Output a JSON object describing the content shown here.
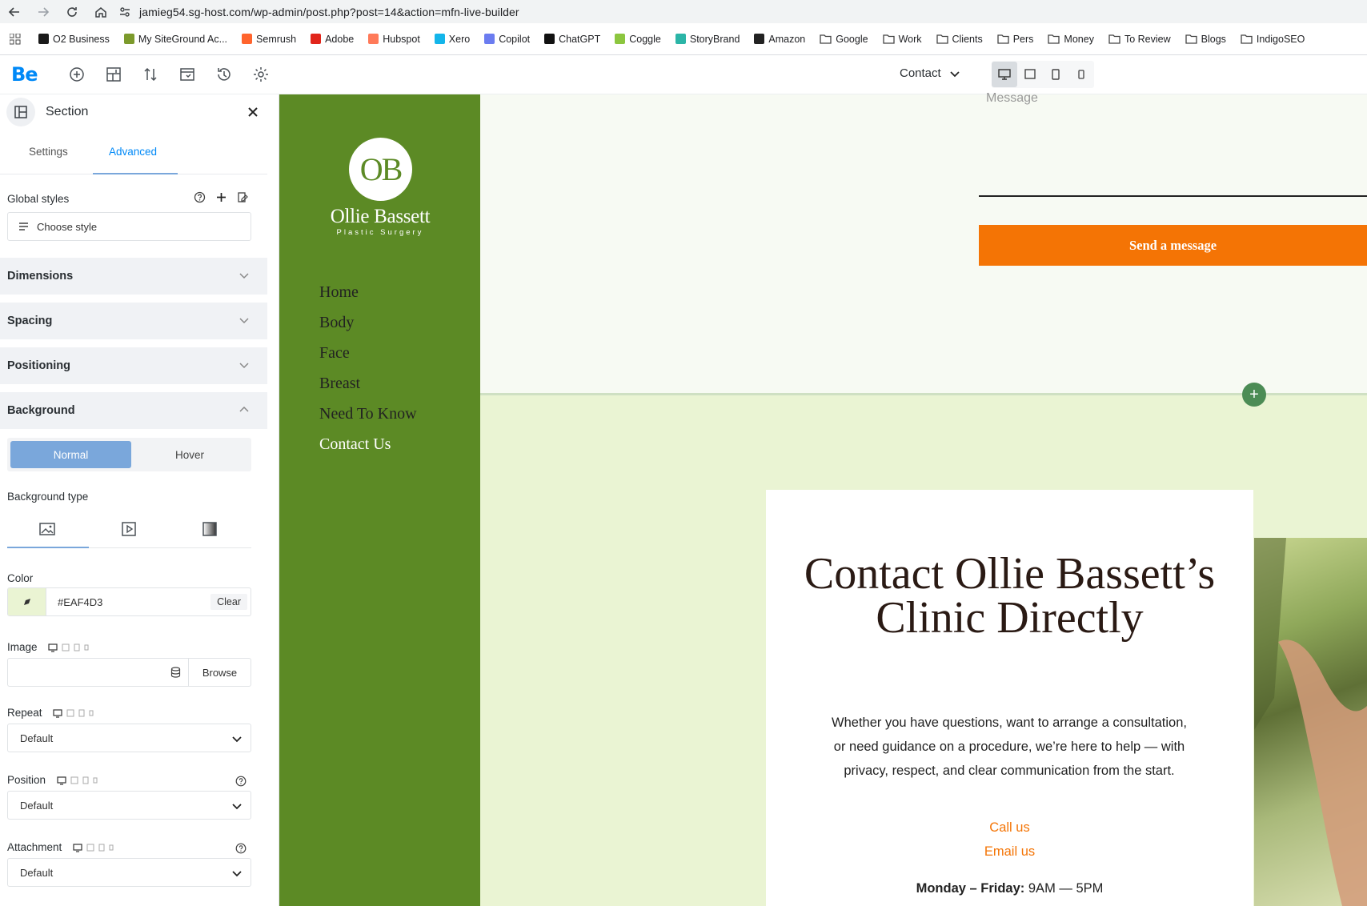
{
  "browser": {
    "url": "jamieg54.sg-host.com/wp-admin/post.php?post=14&action=mfn-live-builder",
    "bookmarks": [
      {
        "label": "O2 Business",
        "color": "#1a1a1a"
      },
      {
        "label": "My SiteGround Ac...",
        "color": "#7c9a2c"
      },
      {
        "label": "Semrush",
        "color": "#ff642d"
      },
      {
        "label": "Adobe",
        "color": "#e1251b"
      },
      {
        "label": "Hubspot",
        "color": "#ff7a59"
      },
      {
        "label": "Xero",
        "color": "#13b5ea"
      },
      {
        "label": "Copilot",
        "color": "#6b7cf0"
      },
      {
        "label": "ChatGPT",
        "color": "#111111"
      },
      {
        "label": "Coggle",
        "color": "#8cc63f"
      },
      {
        "label": "StoryBrand",
        "color": "#2bb5a7"
      },
      {
        "label": "Amazon",
        "color": "#222222"
      },
      {
        "label": "Google",
        "color": "folder"
      },
      {
        "label": "Work",
        "color": "folder"
      },
      {
        "label": "Clients",
        "color": "folder"
      },
      {
        "label": "Pers",
        "color": "folder"
      },
      {
        "label": "Money",
        "color": "folder"
      },
      {
        "label": "To Review",
        "color": "folder"
      },
      {
        "label": "Blogs",
        "color": "folder"
      },
      {
        "label": "IndigoSEO",
        "color": "folder"
      }
    ]
  },
  "builder": {
    "logo": "Be",
    "page_select": "Contact"
  },
  "panel": {
    "title": "Section",
    "tabs": [
      "Settings",
      "Advanced"
    ],
    "global_styles_label": "Global styles",
    "choose_style": "Choose style",
    "sections": [
      "Dimensions",
      "Spacing",
      "Positioning",
      "Background"
    ],
    "state_normal": "Normal",
    "state_hover": "Hover",
    "bg_type_label": "Background type",
    "color_label": "Color",
    "color_value": "#EAF4D3",
    "clear_label": "Clear",
    "image_label": "Image",
    "browse_label": "Browse",
    "repeat_label": "Repeat",
    "repeat_value": "Default",
    "position_label": "Position",
    "position_value": "Default",
    "attachment_label": "Attachment",
    "attachment_value": "Default"
  },
  "site": {
    "logo_initials": "OB",
    "brand_name": "Ollie Bassett",
    "brand_sub": "Plastic Surgery",
    "nav": [
      "Home",
      "Body",
      "Face",
      "Breast",
      "Need To Know",
      "Contact Us"
    ],
    "message_placeholder": "Message",
    "send_button": "Send a message",
    "heading": "Contact Ollie Bassett’s Clinic Directly",
    "paragraph": "Whether you have questions, want to arrange a consultation, or need guidance on a procedure, we’re here to help — with privacy, respect, and clear communication from the start.",
    "call_us": "Call us",
    "email_us": "Email us",
    "hours_days": "Monday – Friday:",
    "hours_time": " 9AM — 5PM"
  },
  "colors": {
    "sidebar_green": "#5C8A25",
    "accent_orange": "#F47405",
    "section_bg": "#EAF4D3",
    "builder_blue": "#0089F7"
  }
}
